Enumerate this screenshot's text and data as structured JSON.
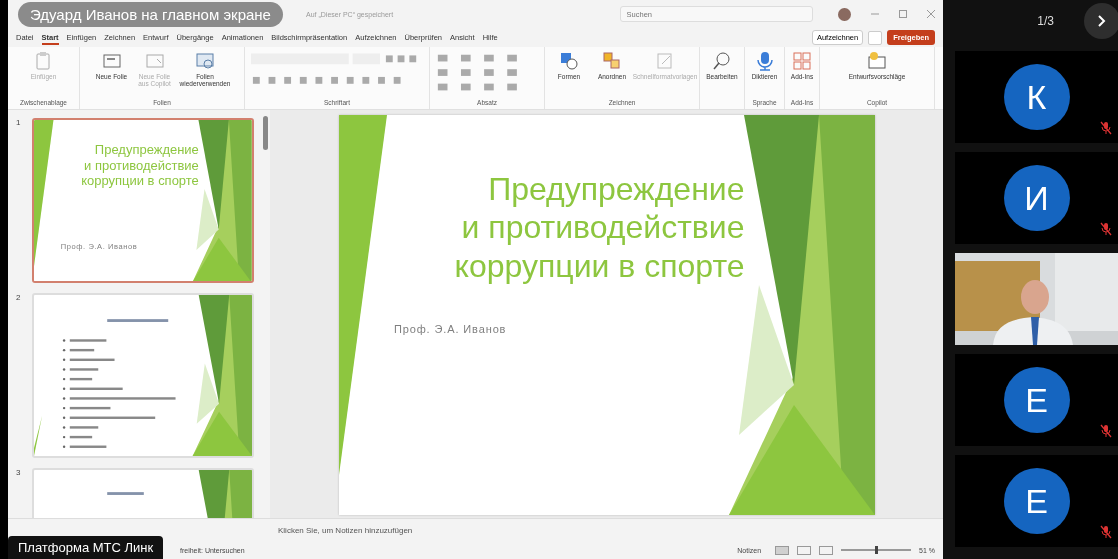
{
  "call": {
    "presenter_banner": "Эдуард Иванов на главном экране",
    "platform_label": "Платформа МТС Линк",
    "page_indicator": "1/3",
    "participants": [
      {
        "kind": "avatar",
        "initial": "К",
        "muted": true
      },
      {
        "kind": "avatar",
        "initial": "И",
        "muted": true
      },
      {
        "kind": "video",
        "muted": false
      },
      {
        "kind": "avatar",
        "initial": "Е",
        "muted": true
      },
      {
        "kind": "avatar",
        "initial": "Е",
        "muted": true
      }
    ]
  },
  "app": {
    "document_title": "Auf „Dieser PC“ gespeichert",
    "search": {
      "placeholder": "Suchen"
    },
    "tabs": [
      {
        "label": "Datei",
        "selected": false
      },
      {
        "label": "Start",
        "selected": true
      },
      {
        "label": "Einfügen",
        "selected": false
      },
      {
        "label": "Zeichnen",
        "selected": false
      },
      {
        "label": "Entwurf",
        "selected": false
      },
      {
        "label": "Übergänge",
        "selected": false
      },
      {
        "label": "Animationen",
        "selected": false
      },
      {
        "label": "Bildschirmpräsentation",
        "selected": false
      },
      {
        "label": "Aufzeichnen",
        "selected": false
      },
      {
        "label": "Überprüfen",
        "selected": false
      },
      {
        "label": "Ansicht",
        "selected": false
      },
      {
        "label": "Hilfe",
        "selected": false
      }
    ],
    "record_button": "Aufzeichnen",
    "share_button": "Freigeben",
    "ribbon_groups": [
      {
        "label": "Zwischenablage",
        "kind": "buttons",
        "buttons": [
          {
            "label": "Einfügen",
            "disabled": true
          }
        ]
      },
      {
        "label": "Folien",
        "kind": "buttons",
        "buttons": [
          {
            "label": "Neue Folie",
            "disabled": false
          },
          {
            "label": "Neue Folie aus Copilot",
            "disabled": true
          },
          {
            "label": "Folien wiederverwenden",
            "disabled": false
          }
        ]
      },
      {
        "label": "Schriftart",
        "kind": "font"
      },
      {
        "label": "Absatz",
        "kind": "paragraph"
      },
      {
        "label": "Zeichnen",
        "kind": "buttons",
        "buttons": [
          {
            "label": "Formen",
            "disabled": false
          },
          {
            "label": "Anordnen",
            "disabled": false
          },
          {
            "label": "Schnellformatvorlagen",
            "disabled": true
          }
        ]
      },
      {
        "kind": "buttons",
        "buttons": [
          {
            "label": "Bearbeiten",
            "disabled": false
          }
        ]
      },
      {
        "label": "Sprache",
        "kind": "buttons",
        "buttons": [
          {
            "label": "Diktieren",
            "disabled": false
          }
        ]
      },
      {
        "label": "Add-Ins",
        "kind": "buttons",
        "buttons": [
          {
            "label": "Add-Ins",
            "disabled": false
          }
        ]
      },
      {
        "label": "Copilot",
        "kind": "buttons",
        "buttons": [
          {
            "label": "Entwurfsvorschläge",
            "disabled": false
          }
        ]
      }
    ],
    "slide": {
      "title_lines": [
        "Предупреждение",
        "и противодействие",
        "коррупции в спорте"
      ],
      "subtitle": "Проф. Э.А. Иванов"
    },
    "thumbnails": [
      {
        "number": "1",
        "kind": "title",
        "selected": true,
        "title_lines": [
          "Предупреждение",
          "и противодействие",
          "коррупции в спорте"
        ],
        "subtitle": "Проф. Э.А. Иванов"
      },
      {
        "number": "2",
        "kind": "list",
        "selected": false
      },
      {
        "number": "3",
        "kind": "list",
        "selected": false
      }
    ],
    "notes_placeholder": "Klicken Sie, um Notizen hinzuzufügen",
    "status_bar": {
      "accessibility": "freiheit: Untersuchen",
      "notes_button": "Notizen",
      "zoom": "51 %",
      "zoom_slider": {
        "level": 0.5
      }
    }
  }
}
